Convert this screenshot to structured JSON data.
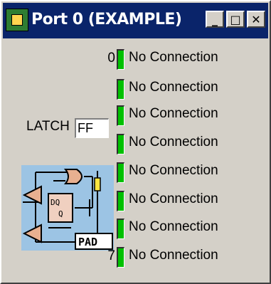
{
  "window": {
    "title": "Port 0 (EXAMPLE)",
    "minimize_glyph": "_",
    "maximize_glyph": "□",
    "close_glyph": "✕"
  },
  "latch": {
    "label": "LATCH",
    "value": "FF"
  },
  "diagram": {
    "pad_label": "PAD",
    "dq_label": "DQ",
    "q_label": "Q",
    "bg_color": "#9cc4e4"
  },
  "pins": [
    {
      "bit_label": "0",
      "status": "No Connection"
    },
    {
      "bit_label": "",
      "status": "No Connection"
    },
    {
      "bit_label": "",
      "status": "No Connection"
    },
    {
      "bit_label": "",
      "status": "No Connection"
    },
    {
      "bit_label": "",
      "status": "No Connection"
    },
    {
      "bit_label": "",
      "status": "No Connection"
    },
    {
      "bit_label": "",
      "status": "No Connection"
    },
    {
      "bit_label": "7",
      "status": "No Connection"
    }
  ],
  "colors": {
    "titlebar": "#0a246a",
    "led_on": "#00c000",
    "face": "#d4d0c8"
  }
}
